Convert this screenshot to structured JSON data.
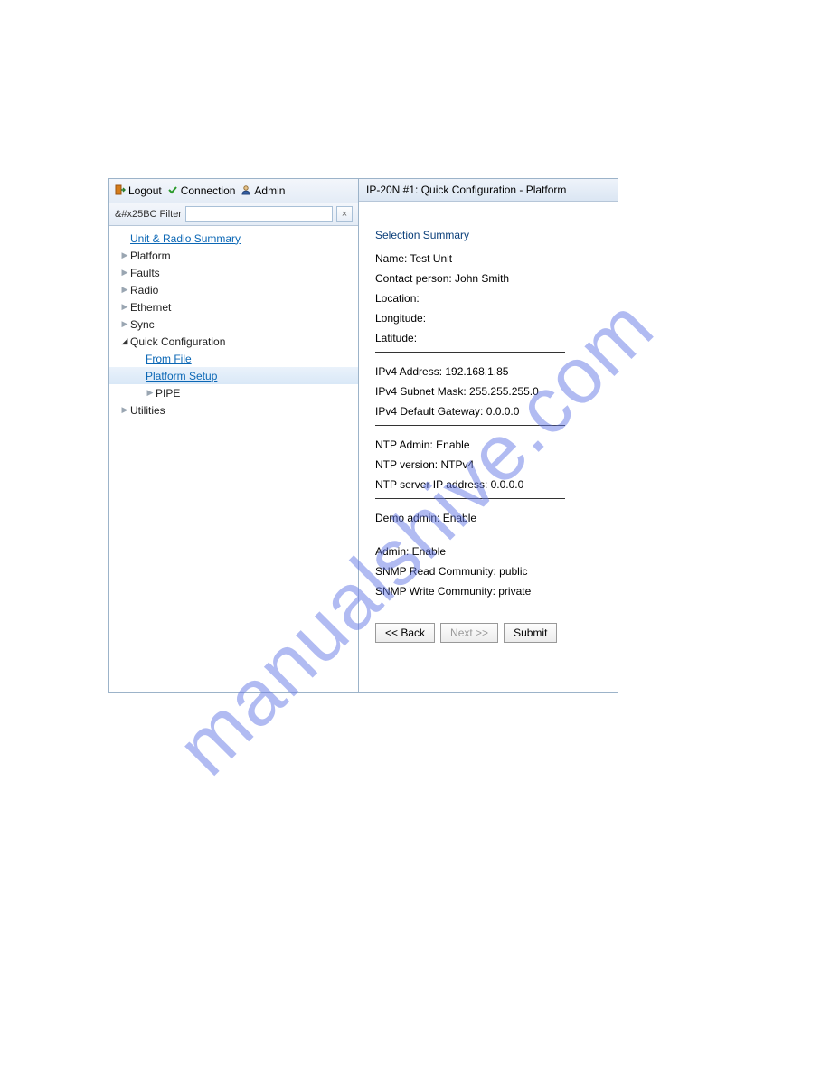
{
  "watermark": "manualshive.com",
  "toolbar": {
    "logout": "Logout",
    "connection": "Connection",
    "admin": "Admin"
  },
  "filter": {
    "label": "&#x25BC Filter",
    "value": "",
    "clear_glyph": "×"
  },
  "tree": {
    "unit_radio_summary": "Unit & Radio Summary",
    "platform": "Platform",
    "faults": "Faults",
    "radio": "Radio",
    "ethernet": "Ethernet",
    "sync": "Sync",
    "quick_configuration": "Quick Configuration",
    "from_file": "From File",
    "platform_setup": "Platform Setup",
    "pipe": "PIPE",
    "utilities": "Utilities"
  },
  "content": {
    "title": "IP-20N #1: Quick Configuration - Platform",
    "section_title": "Selection Summary",
    "rows": {
      "name": "Name: Test Unit",
      "contact": "Contact person: John Smith",
      "location": "Location:",
      "longitude": "Longitude:",
      "latitude": "Latitude:",
      "ipv4_addr": "IPv4 Address: 192.168.1.85",
      "ipv4_mask": "IPv4 Subnet Mask: 255.255.255.0",
      "ipv4_gw": "IPv4 Default Gateway: 0.0.0.0",
      "ntp_admin": "NTP Admin: Enable",
      "ntp_version": "NTP version: NTPv4",
      "ntp_server": "NTP server IP address: 0.0.0.0",
      "demo_admin": "Demo admin: Enable",
      "admin": "Admin: Enable",
      "snmp_read": "SNMP Read Community: public",
      "snmp_write": "SNMP Write Community: private"
    },
    "buttons": {
      "back": "<< Back",
      "next": "Next >>",
      "submit": "Submit"
    }
  }
}
